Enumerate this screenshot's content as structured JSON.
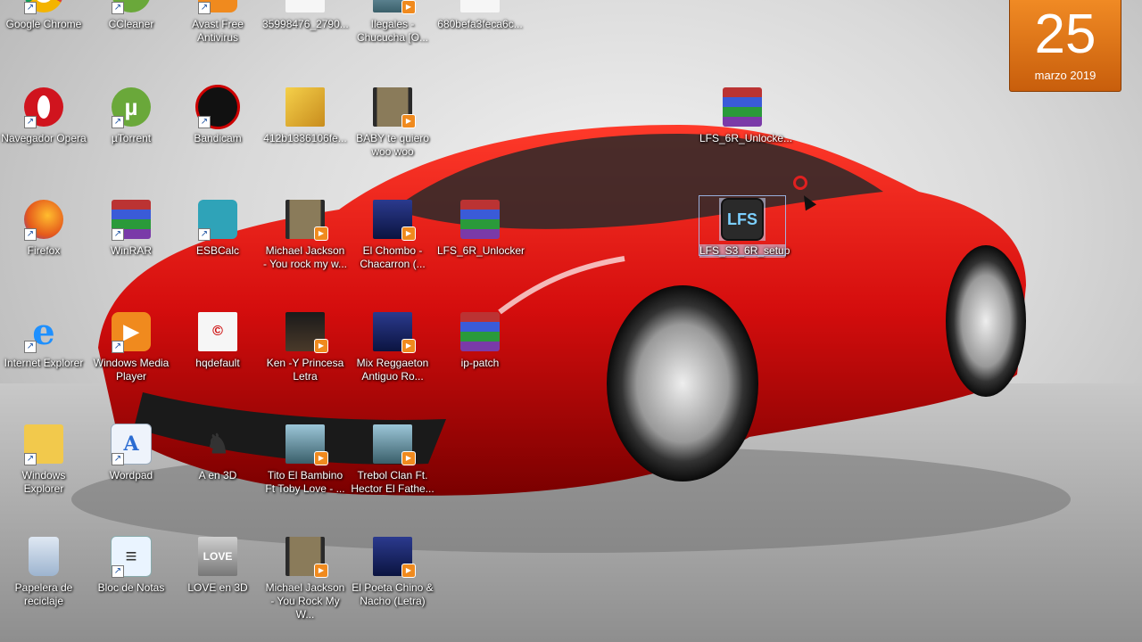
{
  "desktop": {
    "icons": [
      {
        "label": "Google Chrome",
        "icon": "chrome-icon",
        "style": "g-chrome",
        "shortcut": true
      },
      {
        "label": "CCleaner",
        "icon": "ccleaner-icon",
        "style": "g-utorrent",
        "shortcut": true
      },
      {
        "label": "Avast Free Antivirus",
        "icon": "avast-icon",
        "style": "g-wmp",
        "shortcut": true
      },
      {
        "label": "35998476_2790...",
        "icon": "image-thumbnail-icon",
        "style": "g-thumb t-white"
      },
      {
        "label": "Ilegales - Chucucha [O...",
        "icon": "video-thumbnail-icon",
        "style": "g-thumb t-sky",
        "video": true
      },
      {
        "label": "680befa3feca6c...",
        "icon": "file-icon",
        "style": "g-thumb t-white"
      },
      {
        "label": "Navegador Opera",
        "icon": "opera-icon",
        "style": "g-opera",
        "shortcut": true
      },
      {
        "label": "µTorrent",
        "icon": "utorrent-icon",
        "style": "g-utorrent",
        "glyph": "µ",
        "shortcut": true
      },
      {
        "label": "Bandicam",
        "icon": "bandicam-icon",
        "style": "g-bandicam",
        "shortcut": true
      },
      {
        "label": "412b1336106fe...",
        "icon": "image-thumbnail-icon",
        "style": "g-thumb t-yellow"
      },
      {
        "label": "BABY te quiero woo woo",
        "icon": "video-thumbnail-icon",
        "style": "g-thumb t-video",
        "video": true
      },
      {
        "label": "LFS_6R_Unlocke...",
        "icon": "winrar-archive-icon",
        "style": "g-winrar"
      },
      {
        "label": "Firefox",
        "icon": "firefox-icon",
        "style": "g-firefox",
        "shortcut": true
      },
      {
        "label": "WinRAR",
        "icon": "winrar-icon",
        "style": "g-winrar",
        "shortcut": true
      },
      {
        "label": "ESBCalc",
        "icon": "calculator-icon",
        "style": "g-calc",
        "shortcut": true
      },
      {
        "label": "Michael Jackson - You rock my w...",
        "icon": "video-thumbnail-icon",
        "style": "g-thumb t-video",
        "video": true
      },
      {
        "label": "El Chombo - Chacarron (...",
        "icon": "video-thumbnail-icon",
        "style": "g-thumb t-blue",
        "video": true
      },
      {
        "label": "LFS_6R_Unlocker",
        "icon": "winrar-archive-icon",
        "style": "g-winrar"
      },
      {
        "label": "LFS_S3_6R_setup",
        "icon": "lfs-setup-icon",
        "style": "g-lfs",
        "glyph": "LFS",
        "selected": true
      },
      {
        "label": "Internet Explorer",
        "icon": "internet-explorer-icon",
        "style": "g-ie",
        "glyph": "e",
        "shortcut": true
      },
      {
        "label": "Windows Media Player",
        "icon": "media-player-icon",
        "style": "g-wmp",
        "glyph": "▶",
        "shortcut": true
      },
      {
        "label": "hqdefault",
        "icon": "image-thumbnail-icon",
        "style": "g-thumb t-white",
        "glyph": "©"
      },
      {
        "label": "Ken -Y Princesa Letra",
        "icon": "video-thumbnail-icon",
        "style": "g-thumb t-dark",
        "video": true
      },
      {
        "label": "Mix Reggaeton Antiguo Ro...",
        "icon": "video-thumbnail-icon",
        "style": "g-thumb t-blue",
        "video": true
      },
      {
        "label": "ip-patch",
        "icon": "winrar-archive-icon",
        "style": "g-winrar"
      },
      {
        "label": "Windows Explorer",
        "icon": "folder-icon",
        "style": "g-explorer",
        "shortcut": true
      },
      {
        "label": "Wordpad",
        "icon": "wordpad-icon",
        "style": "g-wordpad",
        "glyph": "A",
        "shortcut": true
      },
      {
        "label": "A en 3D",
        "icon": "image-thumbnail-icon",
        "style": "g-person",
        "glyph": "♞"
      },
      {
        "label": "Tito El Bambino Ft Toby Love - ...",
        "icon": "video-thumbnail-icon",
        "style": "g-thumb t-sky",
        "video": true
      },
      {
        "label": "Trebol Clan Ft. Hector El Fathe...",
        "icon": "video-thumbnail-icon",
        "style": "g-thumb t-sky",
        "video": true
      },
      {
        "label": "Papelera de reciclaje",
        "icon": "recycle-bin-icon",
        "style": "g-trash"
      },
      {
        "label": "Bloc de Notas",
        "icon": "notepad-icon",
        "style": "g-notes",
        "glyph": "≡",
        "shortcut": true
      },
      {
        "label": "LOVE en 3D",
        "icon": "image-thumbnail-icon",
        "style": "g-thumb t-love",
        "glyph": "LOVE"
      },
      {
        "label": "Michael Jackson - You Rock My W...",
        "icon": "video-thumbnail-icon",
        "style": "g-thumb t-video",
        "video": true
      },
      {
        "label": "El Poeta Chino & Nacho (Letra)",
        "icon": "video-thumbnail-icon",
        "style": "g-thumb t-blue",
        "video": true
      }
    ]
  },
  "calendar": {
    "day": "25",
    "month": "marzo 2019"
  }
}
